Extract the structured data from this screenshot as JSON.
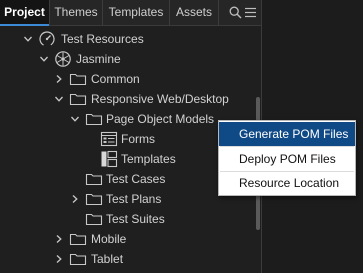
{
  "tabs": [
    {
      "label": "Project",
      "active": true
    },
    {
      "label": "Themes",
      "active": false
    },
    {
      "label": "Templates",
      "active": false
    },
    {
      "label": "Assets",
      "active": false
    }
  ],
  "tab_tools": {
    "search_icon": "search-icon",
    "menu_icon": "hamburger-menu-icon"
  },
  "tree": {
    "test_resources": "Test Resources",
    "jasmine": "Jasmine",
    "common": "Common",
    "responsive": "Responsive Web/Desktop",
    "pom": "Page Object Models",
    "forms": "Forms",
    "templates": "Templates",
    "test_cases": "Test Cases",
    "test_plans": "Test Plans",
    "test_suites": "Test Suites",
    "mobile": "Mobile",
    "tablet": "Tablet"
  },
  "context_menu": {
    "generate": "Generate POM Files",
    "deploy": "Deploy POM Files",
    "resource_location": "Resource Location"
  },
  "colors": {
    "accent": "#3b8bd9",
    "menu_highlight": "#0f4a86",
    "background": "#1f1f1f"
  }
}
